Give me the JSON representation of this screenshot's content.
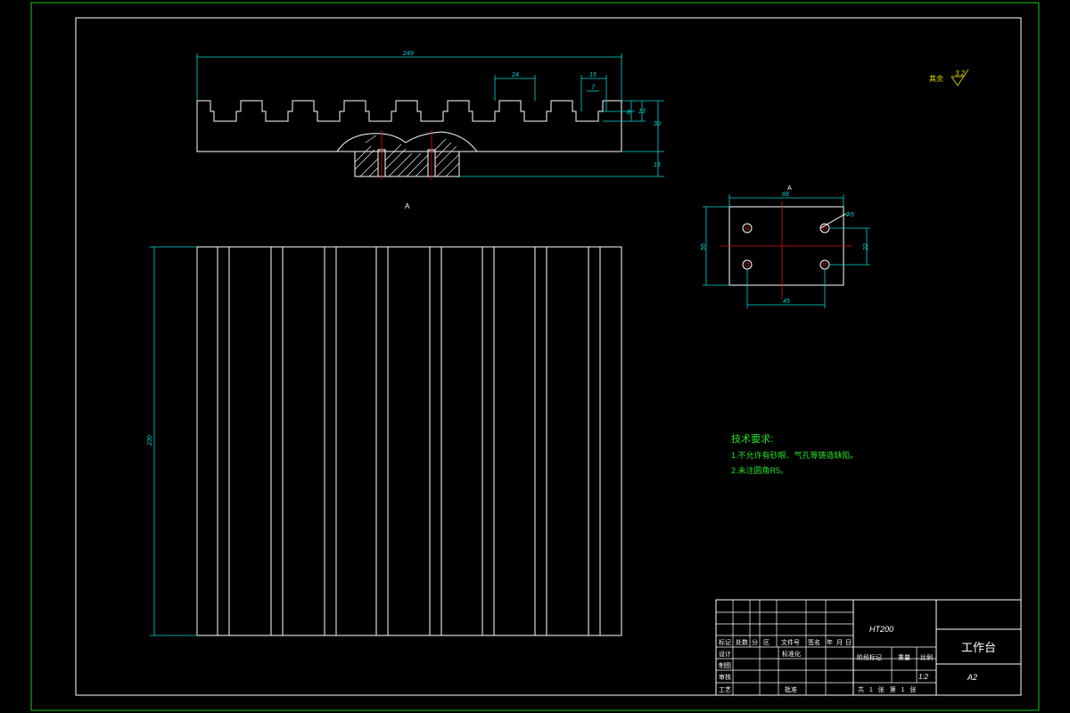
{
  "title_block": {
    "material": "HT200",
    "part_name": "工作台",
    "drawing_no": "A2",
    "scale": "1:2",
    "headers": [
      "标记",
      "处数",
      "分",
      "区",
      "文件号",
      "签名",
      "年",
      "月",
      "日"
    ],
    "row_labels": [
      "设计",
      "制图",
      "审核",
      "工艺"
    ],
    "standardize_label": "标准化",
    "approve_label": "批准",
    "stage_mark_label": "阶段标记",
    "weight_label": "重量",
    "scale_label": "比例",
    "sheets_text": "共 1 张 第 1 张"
  },
  "dimensions": {
    "overall_length": "249",
    "slot_pitch": "24",
    "slot_top_width": "15",
    "slot_neck_width": "7",
    "slot_dim_1": "8",
    "slot_dim_2": "13",
    "thickness": "30",
    "base_height": "15",
    "plan_length": "230",
    "detail_width": "68",
    "detail_height": "55",
    "hole_spacing_x": "45",
    "hole_spacing_y": "22",
    "hole_dia": "Φ5"
  },
  "section_label": "A",
  "detail_label": "A",
  "surface_finish": {
    "label": "其余",
    "value": "3.2"
  },
  "tech_requirements": {
    "title": "技术要求:",
    "items": [
      "1.不允许有砂眼、气孔等铸造缺陷。",
      "2.未注圆角R5。"
    ]
  }
}
